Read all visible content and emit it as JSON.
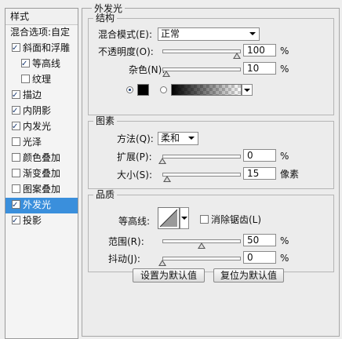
{
  "sidebar": {
    "title": "样式",
    "items": [
      {
        "label": "混合选项:自定",
        "checkbox": false,
        "checked": false,
        "sub": false,
        "selected": false
      },
      {
        "label": "斜面和浮雕",
        "checkbox": true,
        "checked": true,
        "sub": false,
        "selected": false
      },
      {
        "label": "等高线",
        "checkbox": true,
        "checked": true,
        "sub": true,
        "selected": false
      },
      {
        "label": "纹理",
        "checkbox": true,
        "checked": false,
        "sub": true,
        "selected": false
      },
      {
        "label": "描边",
        "checkbox": true,
        "checked": true,
        "sub": false,
        "selected": false
      },
      {
        "label": "内阴影",
        "checkbox": true,
        "checked": true,
        "sub": false,
        "selected": false
      },
      {
        "label": "内发光",
        "checkbox": true,
        "checked": true,
        "sub": false,
        "selected": false
      },
      {
        "label": "光泽",
        "checkbox": true,
        "checked": false,
        "sub": false,
        "selected": false
      },
      {
        "label": "颜色叠加",
        "checkbox": true,
        "checked": false,
        "sub": false,
        "selected": false
      },
      {
        "label": "渐变叠加",
        "checkbox": true,
        "checked": false,
        "sub": false,
        "selected": false
      },
      {
        "label": "图案叠加",
        "checkbox": true,
        "checked": false,
        "sub": false,
        "selected": false
      },
      {
        "label": "外发光",
        "checkbox": true,
        "checked": true,
        "sub": false,
        "selected": true
      },
      {
        "label": "投影",
        "checkbox": true,
        "checked": true,
        "sub": false,
        "selected": false
      }
    ]
  },
  "panel": {
    "title": "外发光",
    "structure": {
      "title": "结构",
      "blend_mode_label": "混合模式(E):",
      "blend_mode_value": "正常",
      "opacity_label": "不透明度(O):",
      "opacity_value": "100",
      "opacity_level": 1.0,
      "noise_label": "杂色(N):",
      "noise_value": "10",
      "noise_level": 0.1,
      "unit": "%",
      "color_radio_selected": true,
      "gradient_radio_selected": false
    },
    "elements": {
      "title": "图素",
      "technique_label": "方法(Q):",
      "technique_value": "柔和",
      "spread_label": "扩展(P):",
      "spread_value": "0",
      "spread_level": 0.0,
      "spread_unit": "%",
      "size_label": "大小(S):",
      "size_value": "15",
      "size_level": 0.06,
      "size_unit": "像素"
    },
    "quality": {
      "title": "品质",
      "contour_label": "等高线:",
      "antialias_label": "消除锯齿(L)",
      "antialias_checked": false,
      "range_label": "范围(R):",
      "range_value": "50",
      "range_level": 0.5,
      "range_unit": "%",
      "jitter_label": "抖动(J):",
      "jitter_value": "0",
      "jitter_level": 0.0,
      "jitter_unit": "%"
    },
    "buttons": {
      "set_default": "设置为默认值",
      "reset_default": "复位为默认值"
    }
  },
  "colors": {
    "selected_bg": "#3a8fdc",
    "glow_color": "#000000"
  }
}
